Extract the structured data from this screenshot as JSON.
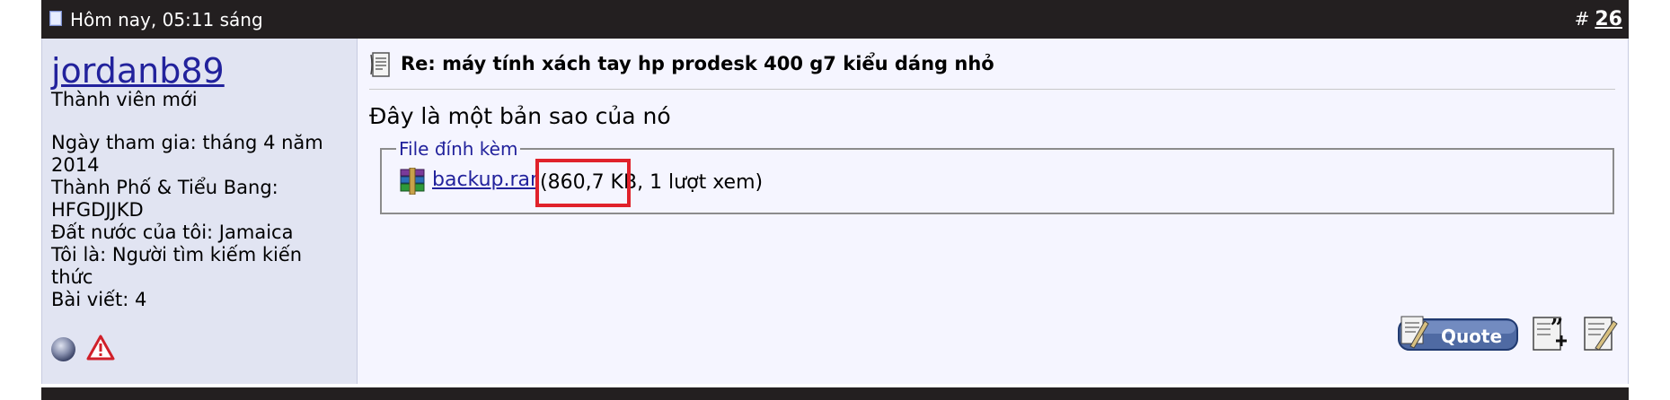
{
  "header": {
    "date": "Hôm nay, 05:11 sáng",
    "hash": "#",
    "post_number": "26"
  },
  "user": {
    "username": "jordanb89",
    "title": "Thành viên mới",
    "info": [
      "Ngày tham gia: tháng 4 năm 2014",
      "Thành Phố & Tiểu Bang: HFGDJJKD",
      "Đất nước của tôi: Jamaica",
      "Tôi là: Người tìm kiếm kiến thức",
      "Bài viết: 4"
    ],
    "icons": [
      "offline-status-icon",
      "report-warning-icon"
    ]
  },
  "post": {
    "title": "Re: máy tính xách tay hp prodesk 400 g7 kiểu dáng nhỏ",
    "body": "Đây là một bản sao của nó",
    "attachments": {
      "legend": "File đính kèm",
      "file_name": "backup.rar",
      "file_meta": "(860,7 KB, 1 lượt xem)"
    }
  },
  "buttons": {
    "quote": "Quote",
    "multiquote_icon": "multiquote-icon",
    "edit_icon": "edit-icon"
  },
  "colors": {
    "header_bg": "#231f20",
    "user_col_bg": "#e1e4f2",
    "link": "#22229c",
    "highlight": "#e0222b"
  }
}
